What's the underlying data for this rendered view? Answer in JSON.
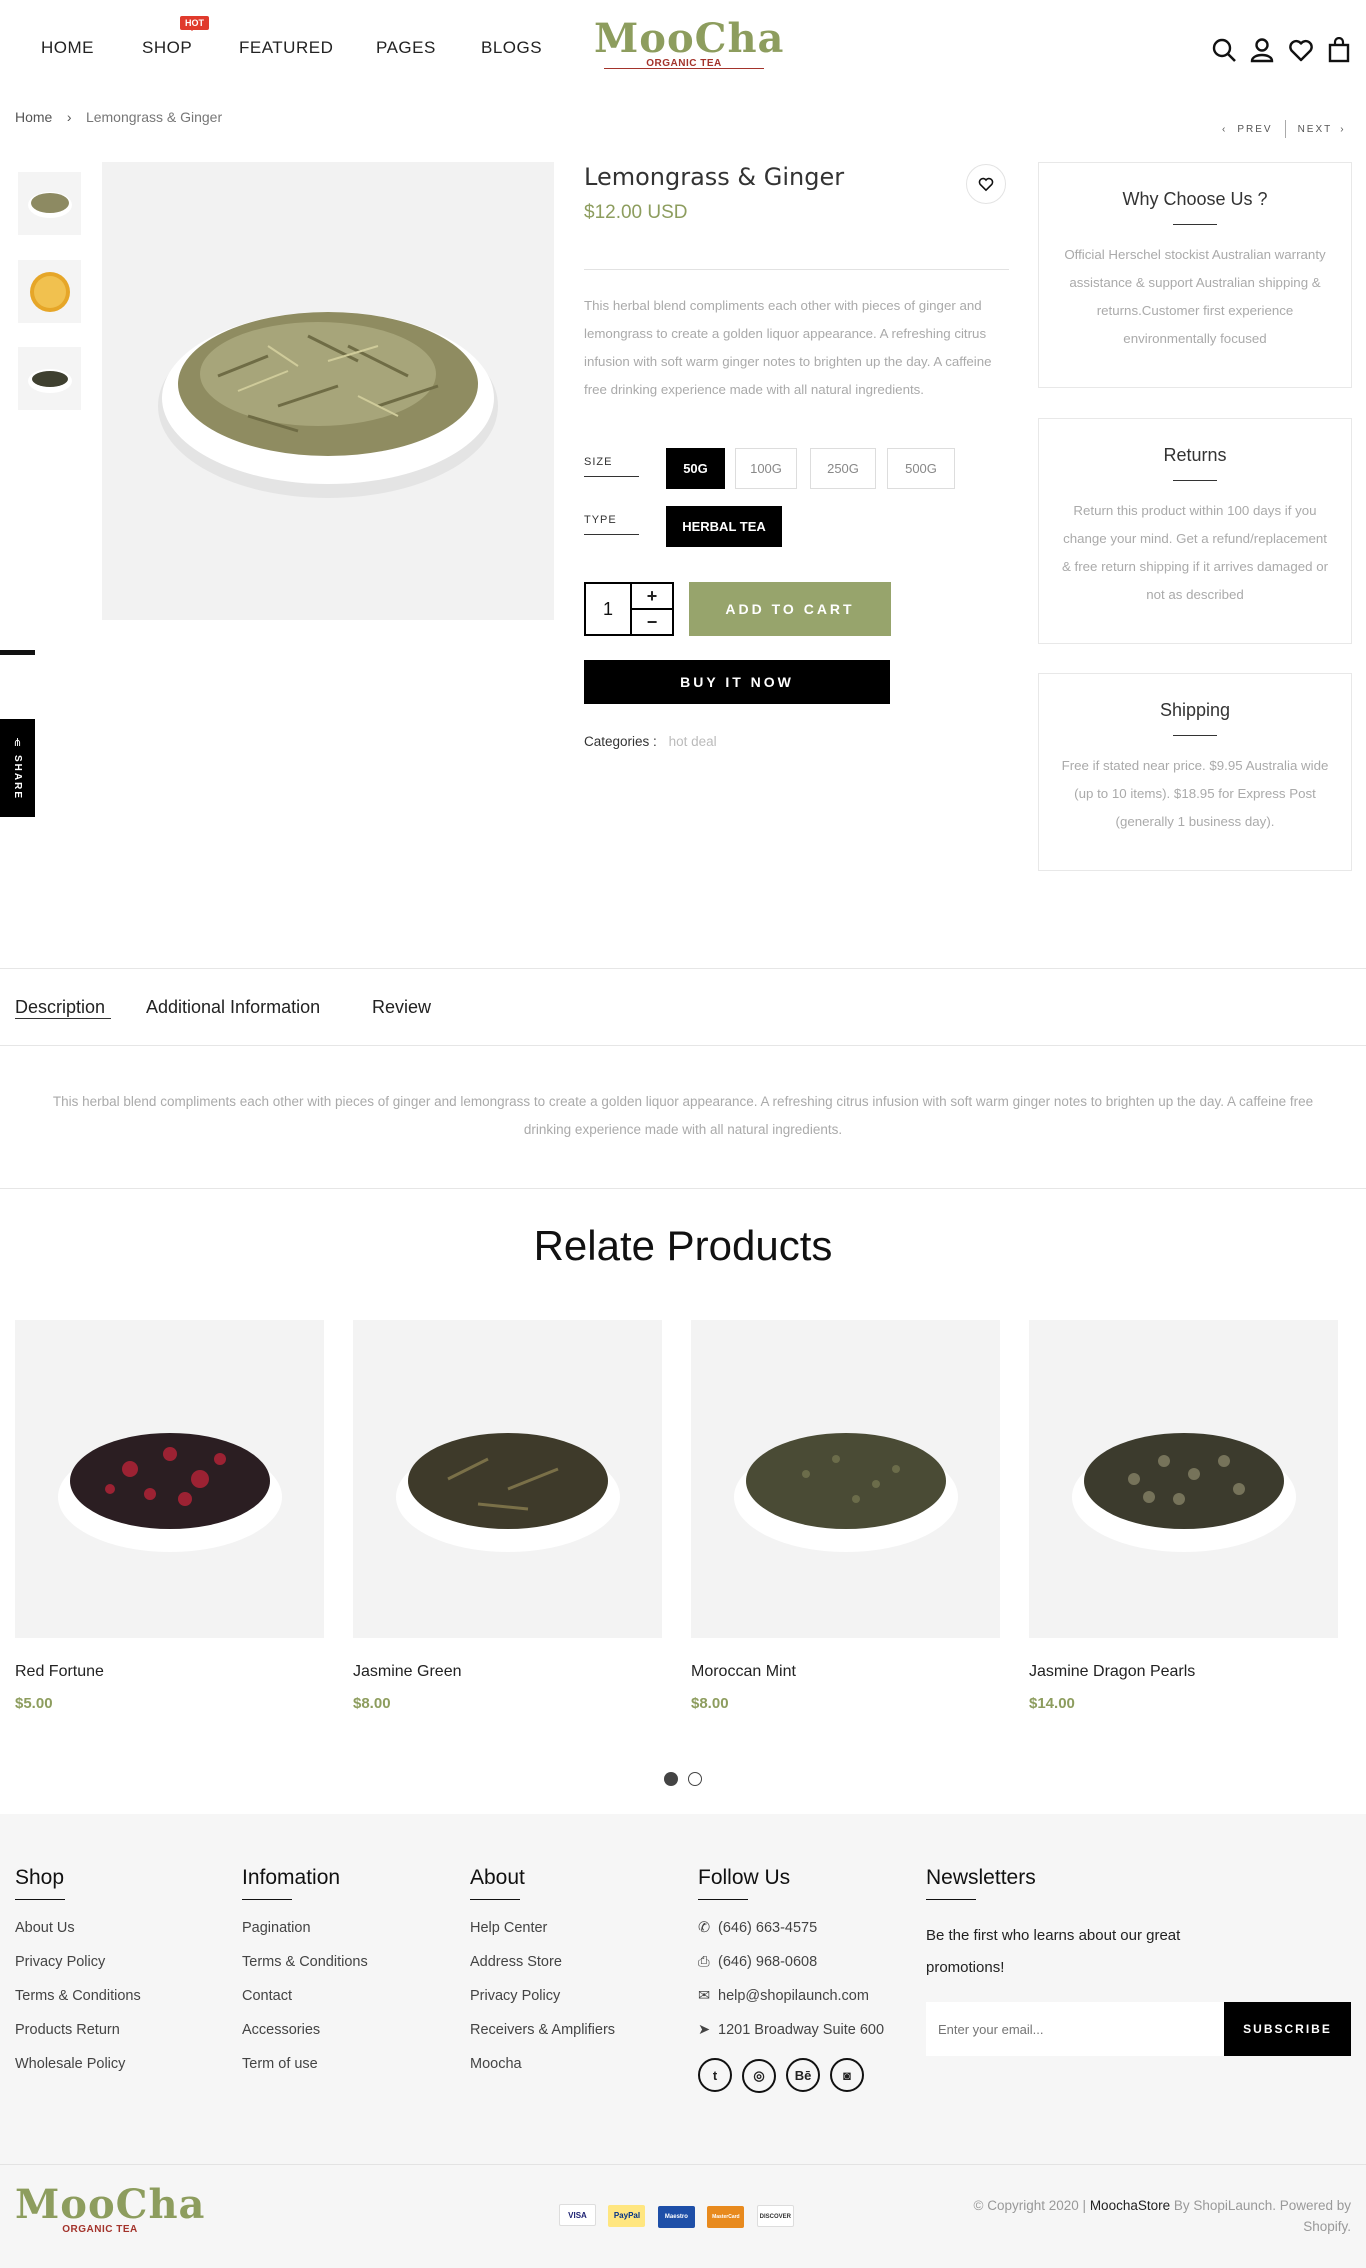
{
  "header": {
    "nav": [
      "HOME",
      "SHOP",
      "FEATURED",
      "PAGES",
      "BLOGS"
    ],
    "hot_badge": "HOT",
    "logo_title": "MooCha",
    "logo_sub": "ORGANIC TEA"
  },
  "breadcrumb": {
    "home": "Home",
    "sep": "›",
    "current": "Lemongrass & Ginger"
  },
  "pager": {
    "prev": "PREV",
    "next": "NEXT"
  },
  "share": {
    "label": "SHARE"
  },
  "product": {
    "title": "Lemongrass & Ginger",
    "price": "$12.00 USD",
    "description": "This herbal blend compliments each other with pieces of ginger and lemongrass to create a golden liquor appearance. A refreshing citrus infusion with soft warm ginger notes to brighten up the day. A caffeine free drinking experience made with all natural ingredients.",
    "size_label": "SIZE",
    "sizes": [
      "50G",
      "100G",
      "250G",
      "500G"
    ],
    "selected_size": "50G",
    "type_label": "TYPE",
    "types": [
      "HERBAL TEA"
    ],
    "quantity": "1",
    "add_to_cart": "ADD TO CART",
    "buy_now": "BUY IT NOW",
    "categories_label": "Categories :",
    "category": "hot deal"
  },
  "side_boxes": [
    {
      "title": "Why Choose Us ?",
      "text": "Official Herschel stockist Australian warranty assistance & support Australian shipping & returns.Customer first experience environmentally focused"
    },
    {
      "title": "Returns",
      "text": "Return this product within 100 days if you change your mind. Get a refund/replacement & free return shipping if it arrives damaged or not as described"
    },
    {
      "title": "Shipping",
      "text": "Free if stated near price. $9.95 Australia wide (up to 10 items). $18.95 for Express Post (generally 1 business day)."
    }
  ],
  "tabs": {
    "items": [
      "Description",
      "Additional Information",
      "Review"
    ],
    "active": "Description",
    "content": "This herbal blend compliments each other with pieces of ginger and lemongrass to create a golden liquor appearance. A refreshing citrus infusion with soft warm ginger notes to brighten up the day. A caffeine free drinking experience made with all natural ingredients."
  },
  "related": {
    "title": "Relate Products",
    "items": [
      {
        "name": "Red Fortune",
        "price": "$5.00"
      },
      {
        "name": "Jasmine Green",
        "price": "$8.00"
      },
      {
        "name": "Moroccan Mint",
        "price": "$8.00"
      },
      {
        "name": "Jasmine Dragon Pearls",
        "price": "$14.00"
      }
    ]
  },
  "footer": {
    "cols": [
      {
        "title": "Shop",
        "links": [
          "About Us",
          "Privacy Policy",
          "Terms & Conditions",
          "Products Return",
          "Wholesale Policy"
        ]
      },
      {
        "title": "Infomation",
        "links": [
          "Pagination",
          "Terms & Conditions",
          "Contact",
          "Accessories",
          "Term of use"
        ]
      },
      {
        "title": "About",
        "links": [
          "Help Center",
          "Address Store",
          "Privacy Policy",
          "Receivers & Amplifiers",
          "Moocha"
        ]
      }
    ],
    "follow": {
      "title": "Follow Us",
      "phone": "(646) 663-4575",
      "fax": "(646) 968-0608",
      "email": "help@shopilaunch.com",
      "address": "1201 Broadway Suite 600",
      "social": [
        "twitter-icon",
        "dribbble-icon",
        "behance-icon",
        "instagram-icon"
      ]
    },
    "newsletter": {
      "title": "Newsletters",
      "text": "Be the first who learns about our great promotions!",
      "placeholder": "Enter your email...",
      "button": "SUBSCRIBE"
    },
    "payments": [
      "VISA",
      "PayPal",
      "Maestro",
      "MasterCard",
      "DISCOVER"
    ],
    "copyright_pre": "© Copyright 2020 |",
    "copyright_brand": "MoochaStore",
    "copyright_post": "By ShopiLaunch. Powered by Shopify."
  },
  "colors": {
    "accent": "#8d9d5e",
    "button_green": "#97a46c",
    "hot": "#e03a2c"
  }
}
